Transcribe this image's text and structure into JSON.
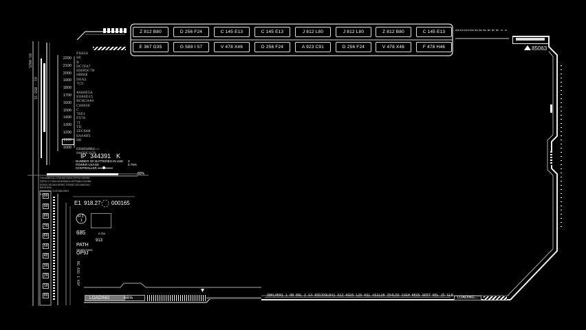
{
  "grid_row1": [
    "Z 812 B80",
    "D 256 F24",
    "C 145 E13",
    "C 145 E13",
    "J 812 L80",
    "J 812 L80",
    "Z 812 B80",
    "C 145 E13"
  ],
  "grid_row2": [
    "E 367 G35",
    "G 589 I 57",
    "V 478 X46",
    "D 256 F24",
    "A 923 C91",
    "D 256 F24",
    "V 478 X46",
    "F 478 H46"
  ],
  "top_right_code": "85063",
  "scale": [
    "2200",
    "2100",
    "2000",
    "1900",
    "1800",
    "1700",
    "1600",
    "1500",
    "1400",
    "1300",
    "1200",
    "1100",
    "1000"
  ],
  "hex_block": "F8A5A\nS6\nB\nDC7FA7\n83695C7B\n8B68E\nDEA2\n7C5\n \n4A80E5A\nE0A9D15\nBCBCA48\nC88938\nC\n76E1\nF578\n71\nTD\n2EC86B\n6AA4B5\nD6\n \n6B1E3992\n846DE3CB",
  "ip_label": "IP",
  "ip_value": "344391",
  "ip_unit": "K",
  "batteries_label": "NUMBER OF BATTERIES IN USE",
  "batteries_value": "3",
  "power_label": "POWER USAGE",
  "power_value": "0.75%",
  "controller_label": "CONTROLLER",
  "bar_percent": "80%",
  "text_lines": [
    "F5A4D8EE4CJ7BD48EF8E8C9FFB19IIE0BE",
    "DEF5CCTS84C6E8D9BE4C6FFB8BC9I3I0BB",
    "6D6SIC9E2AB16E9BCT09BBC1EEA5BD0A1",
    "B8DE3IB6",
    "T0BB9IEE7IC0D9BD28E9",
    "B3"
  ],
  "levels": [
    "00",
    "90",
    "80",
    "70",
    "60",
    "50",
    "40",
    "30",
    "20",
    "10",
    "00"
  ],
  "e1_label": "E1",
  "e1_value": "918.27",
  "code2": "000165",
  "h2_label": "H 2",
  "h2_value": "1",
  "val_685": "685",
  "val_913": "913",
  "val_small": "0.234",
  "path_label": "PATH",
  "path_sub": "SEARCHING",
  "path_value": "OP9J",
  "loading_left": "LOADING",
  "loading_percent": "66%",
  "loading_right": "LOADING...",
  "bottom_text": "OBKLHEN1 1 ON B9L I G4 95DJD9LB41 A1Z  AGU5 LID KSL US2LU8 Z54L5D CUGH KEUS  9D5T KEL  Z5 GLB",
  "vertical_text": "BG ASG 1 KAF"
}
